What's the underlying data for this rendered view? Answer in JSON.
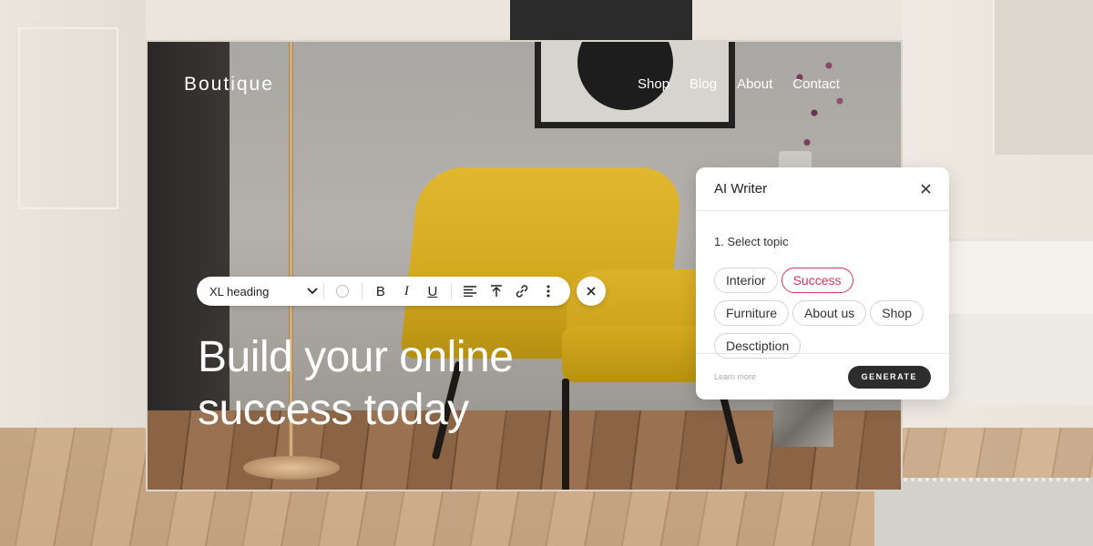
{
  "site": {
    "brand": "Boutique",
    "nav": [
      "Shop",
      "Blog",
      "About",
      "Contact"
    ],
    "headline_line1": "Build your online",
    "headline_line2": "success today"
  },
  "toolbar": {
    "style_select": "XL heading",
    "icons": [
      "chevron-down-icon",
      "color-circle-icon",
      "bold-icon",
      "italic-icon",
      "underline-icon",
      "align-left-icon",
      "align-top-icon",
      "link-icon",
      "more-vertical-icon",
      "close-icon"
    ],
    "bold": "B",
    "italic": "I",
    "underline": "U"
  },
  "ai_writer": {
    "title": "AI Writer",
    "step": "1. Select topic",
    "topics": [
      "Interior",
      "Success",
      "Furniture",
      "About us",
      "Shop",
      "Desctiption"
    ],
    "selected_topic": "Success",
    "learn_more": "Learn more",
    "generate": "GENERATE",
    "accent_color": "#e03358"
  }
}
